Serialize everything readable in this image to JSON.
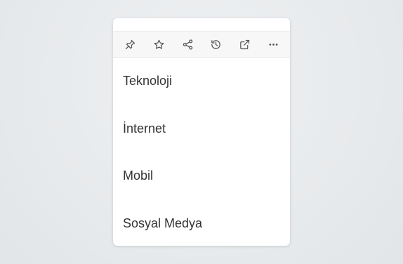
{
  "toolbar": {
    "buttons": [
      {
        "icon": "pin-icon"
      },
      {
        "icon": "star-icon"
      },
      {
        "icon": "share-icon"
      },
      {
        "icon": "history-icon"
      },
      {
        "icon": "external-link-icon"
      },
      {
        "icon": "more-icon"
      }
    ]
  },
  "menu": {
    "items": [
      {
        "label": "Teknoloji"
      },
      {
        "label": "İnternet"
      },
      {
        "label": "Mobil"
      },
      {
        "label": "Sosyal Medya"
      }
    ]
  },
  "colors": {
    "background": "#e9ecee",
    "card": "#ffffff",
    "toolbar": "#f7f7f7",
    "icon": "#555555",
    "text": "#333333"
  }
}
